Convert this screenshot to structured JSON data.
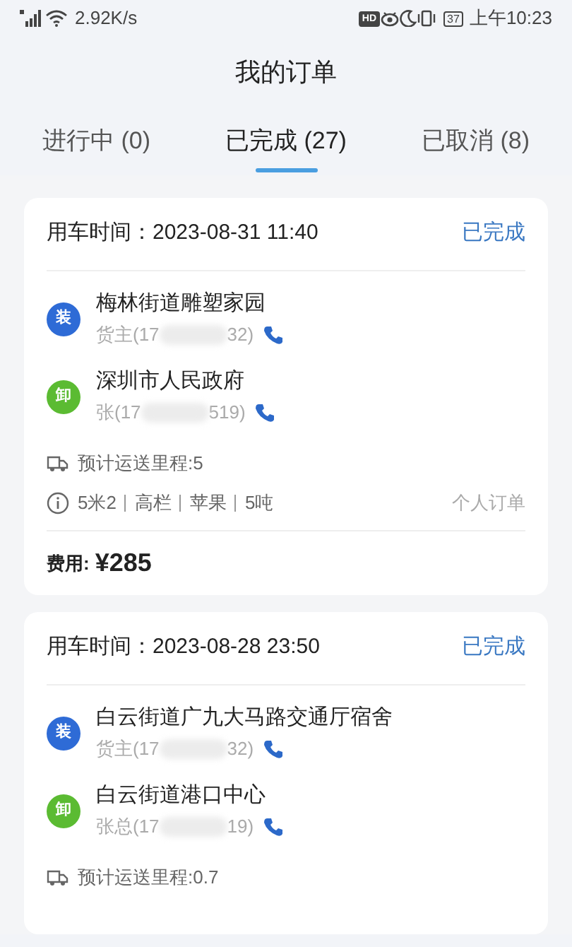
{
  "status_bar": {
    "network_speed": "2.92K/s",
    "hd_badge": "HD",
    "battery": "37",
    "time": "上午10:23"
  },
  "header": {
    "title": "我的订单"
  },
  "tabs": [
    {
      "label": "进行中 (0)",
      "selected": false
    },
    {
      "label": "已完成 (27)",
      "selected": true
    },
    {
      "label": "已取消 (8)",
      "selected": false
    }
  ],
  "orders": [
    {
      "time_label": "用车时间：",
      "time": "2023-08-31 11:40",
      "status": "已完成",
      "stops": [
        {
          "kind": "load",
          "badge": "装",
          "address": "梅林街道雕塑家园",
          "contact_start": "货主(17",
          "contact_end": "32)"
        },
        {
          "kind": "unload",
          "badge": "卸",
          "address": "深圳市人民政府",
          "contact_start": "张(17",
          "contact_end": "519)"
        }
      ],
      "distance": "预计运送里程:5",
      "specs": [
        "5米2",
        "高栏",
        "苹果",
        "5吨"
      ],
      "order_type": "个人订单",
      "fee_label": "费用:",
      "fee": "¥285"
    },
    {
      "time_label": "用车时间：",
      "time": "2023-08-28 23:50",
      "status": "已完成",
      "stops": [
        {
          "kind": "load",
          "badge": "装",
          "address": "白云街道广九大马路交通厅宿舍",
          "contact_start": "货主(17",
          "contact_end": "32)"
        },
        {
          "kind": "unload",
          "badge": "卸",
          "address": "白云街道港口中心",
          "contact_start": "张总(17",
          "contact_end": "19)"
        }
      ],
      "distance": "预计运送里程:0.7"
    }
  ]
}
